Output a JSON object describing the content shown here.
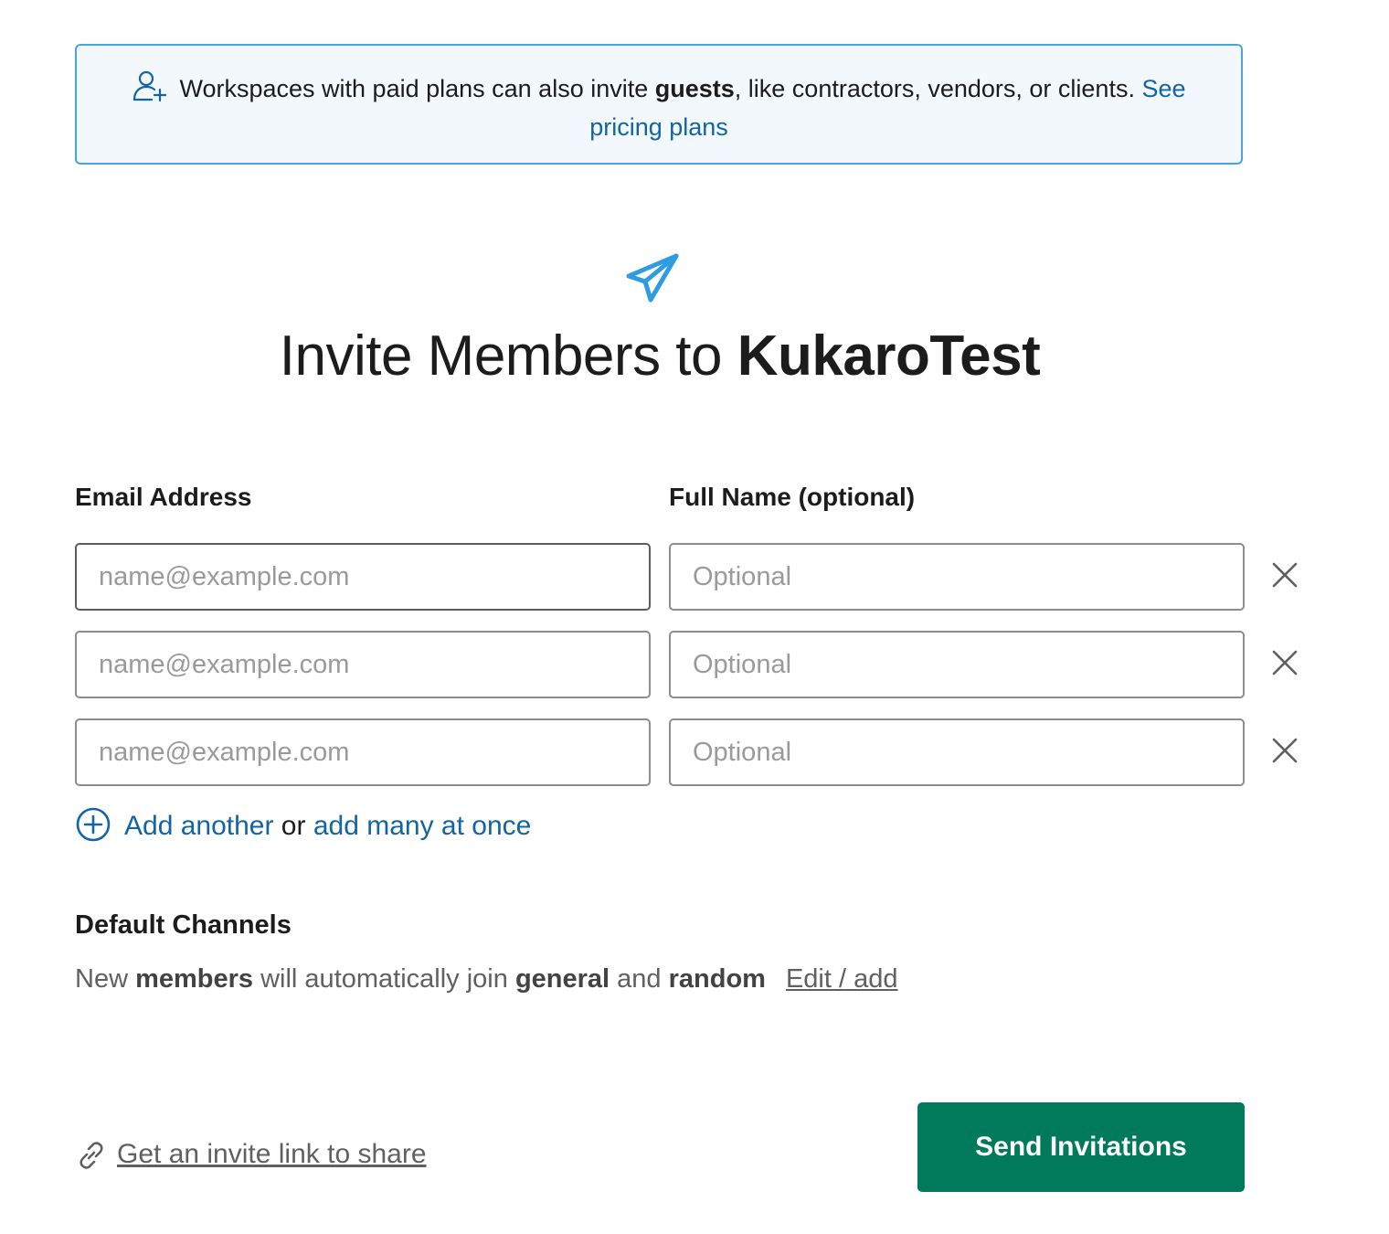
{
  "banner": {
    "text_before": "Workspaces with paid plans can also invite ",
    "bold": "guests",
    "text_after": ", like contractors, vendors, or clients. ",
    "link": "See pricing plans",
    "icon": "add-user-icon"
  },
  "title": {
    "prefix": "Invite Members to ",
    "workspace": "KukaroTest",
    "icon": "paper-plane-icon"
  },
  "columns": {
    "email_label": "Email Address",
    "name_label": "Full Name (optional)"
  },
  "rows": [
    {
      "email_placeholder": "name@example.com",
      "name_placeholder": "Optional",
      "email_value": "",
      "name_value": ""
    },
    {
      "email_placeholder": "name@example.com",
      "name_placeholder": "Optional",
      "email_value": "",
      "name_value": ""
    },
    {
      "email_placeholder": "name@example.com",
      "name_placeholder": "Optional",
      "email_value": "",
      "name_value": ""
    }
  ],
  "add": {
    "add_another": "Add another",
    "or": " or ",
    "add_many": "add many at once"
  },
  "default_channels": {
    "title": "Default Channels",
    "text_new": "New ",
    "members": "members",
    "text_join": " will automatically join ",
    "general": "general",
    "text_and": " and ",
    "random": "random",
    "edit": "Edit / add"
  },
  "footer": {
    "invite_link": "Get an invite link to share",
    "send_button": "Send Invitations"
  },
  "colors": {
    "accent_blue": "#1264a3",
    "icon_blue": "#2f9be0",
    "banner_border": "#4aa3df",
    "banner_bg": "#f2f8fc",
    "send_green": "#007a5a"
  }
}
